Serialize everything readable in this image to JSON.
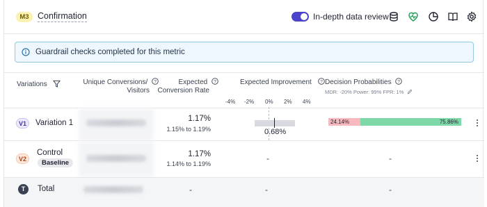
{
  "header": {
    "metric_badge": "M3",
    "title": "Confirmation",
    "toggle_label": "In-depth data review",
    "toggle_on": true,
    "icons": [
      "database-icon",
      "heart-pulse-icon",
      "pie-chart-icon",
      "book-icon",
      "settings-icon"
    ]
  },
  "alert": {
    "text": "Guardrail checks completed for this metric",
    "icon": "info-icon"
  },
  "columns": {
    "variations": "Variations",
    "unique_line1": "Unique Conversions/",
    "unique_line2": "Visitors",
    "expected_line1": "Expected",
    "expected_line2": "Conversion Rate",
    "improvement": "Expected Improvement",
    "decision": "Decision Probabilities",
    "decision_caption": "MDR: -20% Power: 99% FPR: 1%",
    "ticks": [
      "-4%",
      "-2%",
      "0%",
      "2%",
      "4%"
    ]
  },
  "rows": [
    {
      "badge": "V1",
      "name": "Variation 1",
      "conversions": "11,500 / 1,650,000",
      "rate": "1.17%",
      "range": "1.15% to 1.19%",
      "improvement": "0.68%",
      "prob_lose": "24.14%",
      "prob_win": "75.86%",
      "prob_lose_value": 24.14,
      "prob_win_value": 75.86
    },
    {
      "badge": "V2",
      "name": "Control",
      "baseline_label": "Baseline",
      "conversions": "11,400 / 1,650,000",
      "rate": "1.17%",
      "range": "1.14% to 1.19%",
      "improvement": "-",
      "decision": "-"
    },
    {
      "badge": "T",
      "name": "Total",
      "conversions": "22,900 / 3,300,000",
      "rate": "-",
      "improvement": "-",
      "decision": "-"
    }
  ],
  "colors": {
    "accent": "#4b43c9",
    "win": "#7fd8a7",
    "lose": "#f7b9bd",
    "alert_border": "#93c8e6"
  }
}
